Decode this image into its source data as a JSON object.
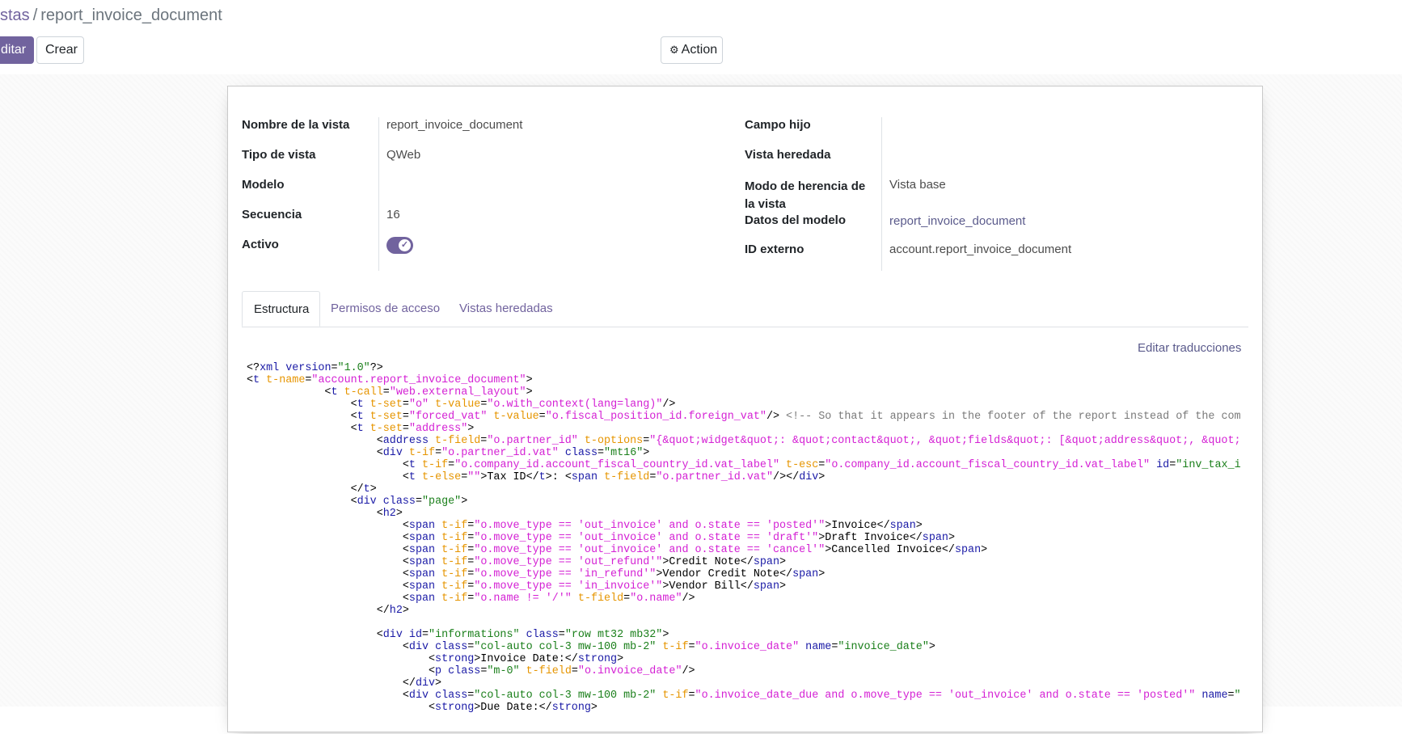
{
  "breadcrumb": {
    "parent": "stas",
    "separator": "/",
    "current": "report_invoice_document"
  },
  "toolbar": {
    "edit_label": "ditar",
    "create_label": "Crear",
    "action_label": "Action",
    "action_icon": "gear-icon"
  },
  "form": {
    "left_fields": [
      {
        "label": "Nombre de la vista",
        "value": "report_invoice_document"
      },
      {
        "label": "Tipo de vista",
        "value": "QWeb"
      },
      {
        "label": "Modelo",
        "value": ""
      },
      {
        "label": "Secuencia",
        "value": "16"
      },
      {
        "label": "Activo",
        "value": ""
      }
    ],
    "right_fields": [
      {
        "label": "Campo hijo",
        "value": ""
      },
      {
        "label": "Vista heredada",
        "value": ""
      },
      {
        "label": "Modo de herencia de la vista",
        "value": "Vista base"
      },
      {
        "label": "Datos del modelo",
        "value": "report_invoice_document"
      },
      {
        "label": "ID externo",
        "value": "account.report_invoice_document"
      }
    ],
    "activo_checked": true
  },
  "tabs": [
    {
      "label": "Estructura",
      "active": true
    },
    {
      "label": "Permisos de acceso",
      "active": false
    },
    {
      "label": "Vistas heredadas",
      "active": false
    }
  ],
  "edit_translations_label": "Editar traducciones",
  "colors": {
    "primary": "#71639e",
    "tag": "#1a1aa6",
    "attr": "#e69500",
    "value": "#d421d4",
    "string": "#1a7f1a",
    "comment": "#7a7a7a"
  },
  "code_lines": [
    "<?xml version=\"1.0\"?>",
    "<t t-name=\"account.report_invoice_document\">",
    "            <t t-call=\"web.external_layout\">",
    "                <t t-set=\"o\" t-value=\"o.with_context(lang=lang)\"/>",
    "                <t t-set=\"forced_vat\" t-value=\"o.fiscal_position_id.foreign_vat\"/> <!-- So that it appears in the footer of the report instead of the com",
    "                <t t-set=\"address\">",
    "                    <address t-field=\"o.partner_id\" t-options=\"{&quot;widget&quot;: &quot;contact&quot;, &quot;fields&quot;: [&quot;address&quot;, &quot;",
    "                    <div t-if=\"o.partner_id.vat\" class=\"mt16\">",
    "                        <t t-if=\"o.company_id.account_fiscal_country_id.vat_label\" t-esc=\"o.company_id.account_fiscal_country_id.vat_label\" id=\"inv_tax_i",
    "                        <t t-else=\"\">Tax ID</t>: <span t-field=\"o.partner_id.vat\"/></div>",
    "                </t>",
    "                <div class=\"page\">",
    "                    <h2>",
    "                        <span t-if=\"o.move_type == 'out_invoice' and o.state == 'posted'\">Invoice</span>",
    "                        <span t-if=\"o.move_type == 'out_invoice' and o.state == 'draft'\">Draft Invoice</span>",
    "                        <span t-if=\"o.move_type == 'out_invoice' and o.state == 'cancel'\">Cancelled Invoice</span>",
    "                        <span t-if=\"o.move_type == 'out_refund'\">Credit Note</span>",
    "                        <span t-if=\"o.move_type == 'in_refund'\">Vendor Credit Note</span>",
    "                        <span t-if=\"o.move_type == 'in_invoice'\">Vendor Bill</span>",
    "                        <span t-if=\"o.name != '/'\" t-field=\"o.name\"/>",
    "                    </h2>",
    "",
    "                    <div id=\"informations\" class=\"row mt32 mb32\">",
    "                        <div class=\"col-auto col-3 mw-100 mb-2\" t-if=\"o.invoice_date\" name=\"invoice_date\">",
    "                            <strong>Invoice Date:</strong>",
    "                            <p class=\"m-0\" t-field=\"o.invoice_date\"/>",
    "                        </div>",
    "                        <div class=\"col-auto col-3 mw-100 mb-2\" t-if=\"o.invoice_date_due and o.move_type == 'out_invoice' and o.state == 'posted'\" name=\"",
    "                            <strong>Due Date:</strong>"
  ]
}
